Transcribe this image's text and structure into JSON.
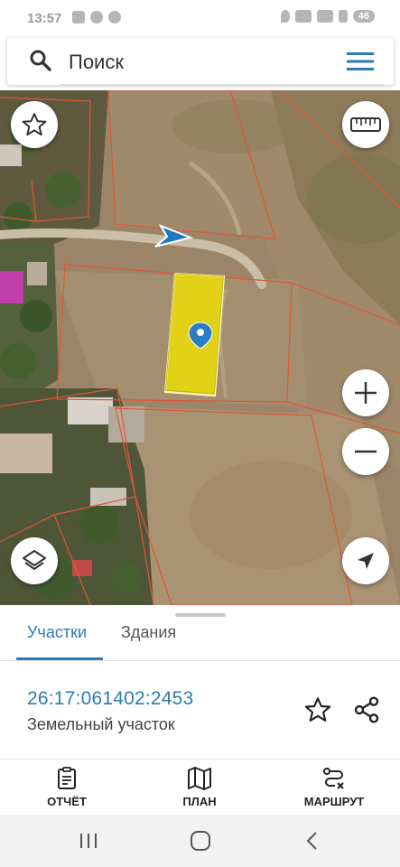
{
  "status_bar": {
    "time": "13:57",
    "battery": "46"
  },
  "search": {
    "placeholder": "Поиск"
  },
  "tabs": [
    {
      "label": "Участки",
      "active": true
    },
    {
      "label": "Здания",
      "active": false
    }
  ],
  "parcel": {
    "number": "26:17:061402:2453",
    "type": "Земельный участок"
  },
  "bottom_nav": [
    {
      "label": "ОТЧЁТ",
      "icon": "report-icon"
    },
    {
      "label": "ПЛАН",
      "icon": "map-plan-icon"
    },
    {
      "label": "МАРШРУТ",
      "icon": "route-icon"
    }
  ],
  "colors": {
    "accent": "#2c7bb0",
    "parcel_fill": "#f2e600",
    "boundary": "#e0573a"
  }
}
